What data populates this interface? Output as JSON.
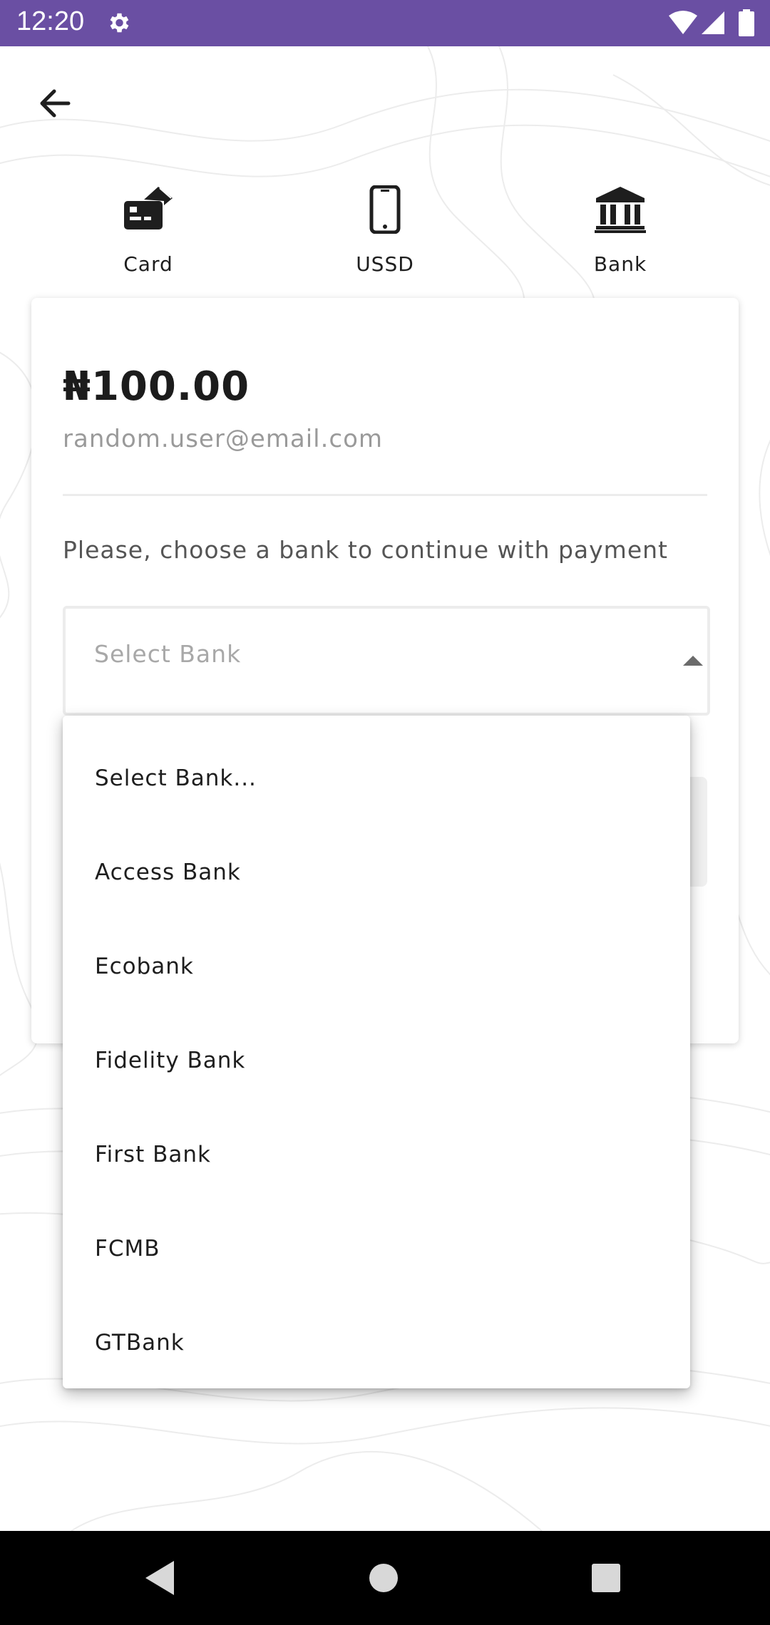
{
  "status_bar": {
    "time": "12:20",
    "background": "#6a4fa3",
    "icons": [
      "gear-icon",
      "wifi-icon",
      "signal-icon",
      "battery-icon"
    ]
  },
  "header": {
    "back_icon": "arrow-left-icon"
  },
  "payment_methods": [
    {
      "label": "Card",
      "icon": "credit-card-icon"
    },
    {
      "label": "USSD",
      "icon": "phone-icon"
    },
    {
      "label": "Bank",
      "icon": "bank-icon"
    }
  ],
  "payment": {
    "amount": "₦100.00",
    "email": "random.user@email.com",
    "instruction": "Please, choose a bank to continue with payment"
  },
  "bank_select": {
    "placeholder": "Select Bank",
    "expanded": true,
    "options": [
      "Select Bank...",
      "Access Bank",
      "Ecobank",
      "Fidelity Bank",
      "First Bank",
      "FCMB",
      "GTBank"
    ]
  },
  "nav_bar": {
    "icons": [
      "back-triangle-icon",
      "home-circle-icon",
      "recents-square-icon"
    ]
  }
}
